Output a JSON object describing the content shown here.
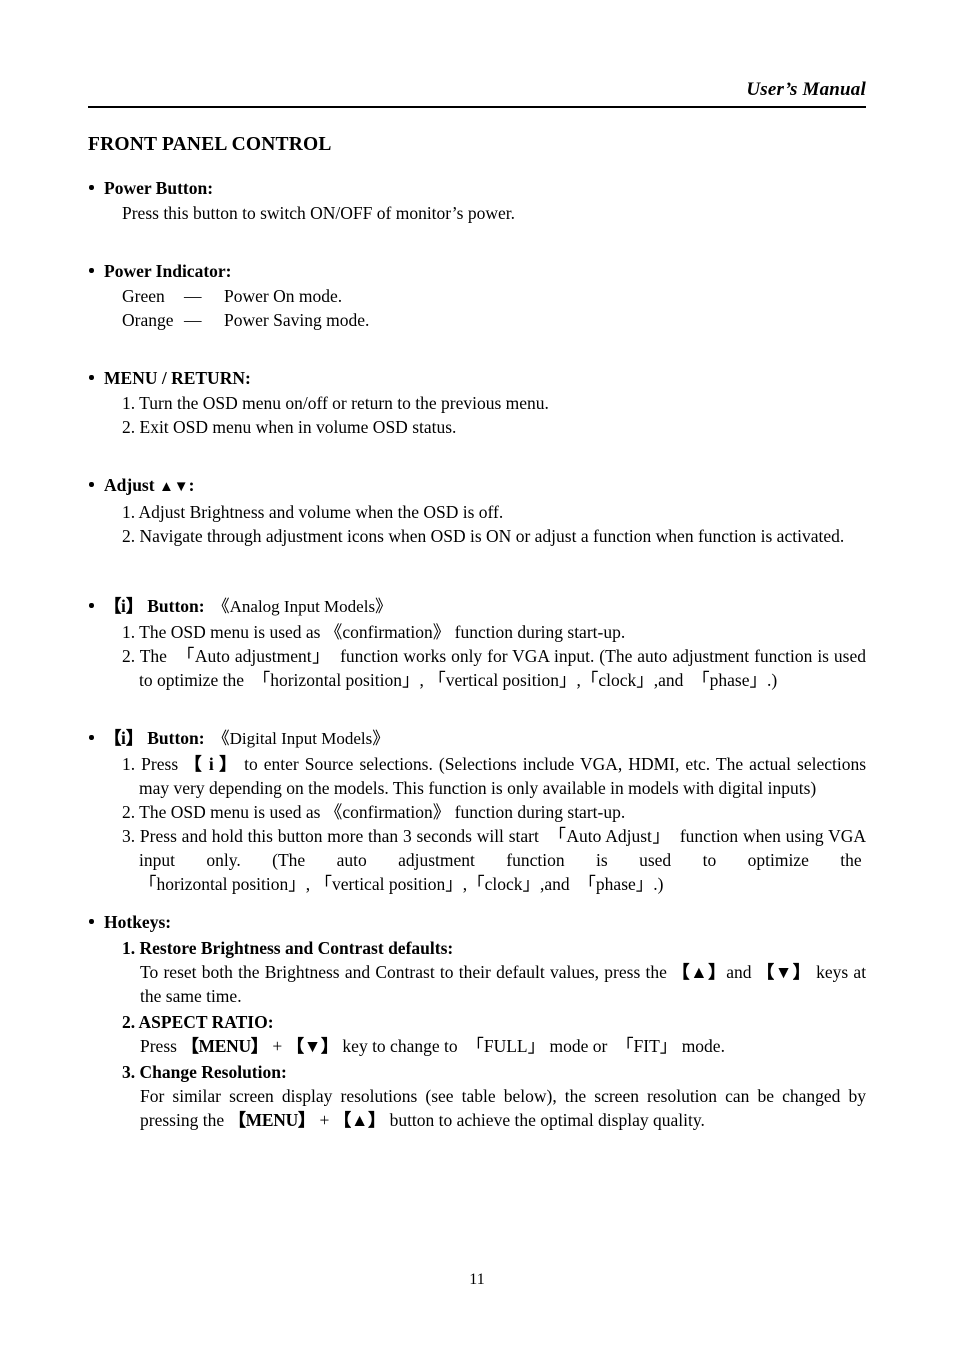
{
  "header": {
    "title": "User’s Manual"
  },
  "section": {
    "title": "FRONT PANEL CONTROL"
  },
  "power_button": {
    "heading": "Power Button:",
    "line1": "Press this button to switch ON/OFF of monitor’s power."
  },
  "power_indicator": {
    "heading": "Power Indicator:",
    "rows": [
      {
        "label": "Green",
        "dash": "—",
        "value": "Power On mode."
      },
      {
        "label": "Orange",
        "dash": "—",
        "value": "Power Saving mode."
      }
    ]
  },
  "menu_return": {
    "heading": "MENU / RETURN:",
    "item1": "1. Turn the OSD menu on/off or return to the previous menu.",
    "item2": "2. Exit OSD menu when in volume OSD status."
  },
  "adjust": {
    "heading_text": "Adjust",
    "heading_arrows": "▲▼",
    "heading_colon": ":",
    "item1": "1. Adjust Brightness and volume when the OSD is off.",
    "item2": "2. Navigate through adjustment icons when OSD is ON or adjust a function when function is activated."
  },
  "i_button_analog": {
    "bracket_open": "【",
    "bracket_label": "i",
    "bracket_close": "】",
    "heading": "Button:",
    "model_note": "《Analog Input Models》",
    "item1": "1. The OSD menu is used as 《confirmation》 function during start-up.",
    "item2_a": "2. The",
    "item2_term1": "「Auto adjustment」",
    "item2_b": "function works only for VGA input. (The auto adjustment function is used to optimize the",
    "item2_term2": "「horizontal position」",
    "item2_c": ",",
    "item2_term3": "「vertical position」",
    "item2_d": ",",
    "item2_term4": "「clock」",
    "item2_e": ",and",
    "item2_term5": "「phase」",
    "item2_f": ".)"
  },
  "i_button_digital": {
    "bracket_open": "【",
    "bracket_label": "i",
    "bracket_close": "】",
    "heading": "Button:",
    "model_note": "《Digital Input Models》",
    "item1_a": "1. Press",
    "item1_key": "【 i 】",
    "item1_b": "to enter Source selections. (Selections include VGA, HDMI, etc. The actual selections may very depending on the models. This function is only available in models with digital inputs)",
    "item2": "2. The OSD menu is used as 《confirmation》 function during start-up.",
    "item3_a": "3. Press and hold this button more than 3 seconds will start",
    "item3_term1": "「Auto Adjust」",
    "item3_b": "function when using VGA input only. (The auto adjustment function is used to optimize the",
    "item3_term2": "「horizontal position」",
    "item3_c": ",",
    "item3_term3": "「vertical position」",
    "item3_d": ",",
    "item3_term4": "「clock」",
    "item3_e": ",and",
    "item3_term5": "「phase」",
    "item3_f": ".)"
  },
  "hotkeys": {
    "heading": "Hotkeys:",
    "item1_title": "1. Restore Brightness and Contrast defaults:",
    "item1_body_a": "To reset both the Brightness and Contrast to their default values, press the",
    "item1_key_up": "【▲】",
    "item1_body_b": "and",
    "item1_key_down": "【▼】",
    "item1_body_c": "keys at the same time.",
    "item2_title": "2. ASPECT RATIO:",
    "item2_body_a": "Press",
    "item2_key_menu": "【MENU】",
    "item2_plus": "+",
    "item2_key_down": "【▼】",
    "item2_body_b": "key to change to",
    "item2_term_full": "「FULL」",
    "item2_body_c": "mode or",
    "item2_term_fit": "「FIT」",
    "item2_body_d": "mode.",
    "item3_title": "3. Change Resolution:",
    "item3_body_a": "For similar screen display resolutions (see table below), the screen resolution can be changed by pressing the",
    "item3_key_menu": "【MENU】",
    "item3_plus": "+",
    "item3_key_up": "【▲】",
    "item3_body_b": "button to achieve the optimal display quality."
  },
  "footer": {
    "page_number": "11"
  }
}
